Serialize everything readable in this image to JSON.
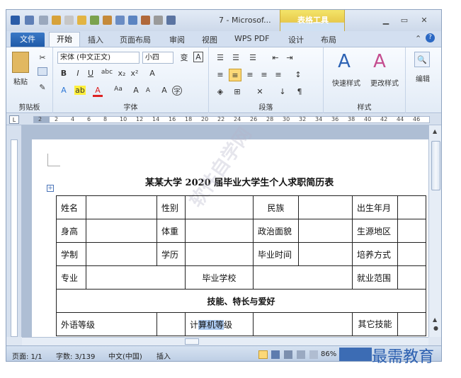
{
  "title_bar": {
    "doc_title": "7 - Microsof...",
    "context_tab": "表格工具"
  },
  "tabs": [
    "文件",
    "开始",
    "插入",
    "页面布局",
    "审阅",
    "视图",
    "WPS PDF",
    "设计",
    "布局"
  ],
  "ribbon": {
    "clipboard": {
      "paste": "粘贴",
      "label": "剪贴板"
    },
    "font": {
      "font_name": "宋体 (中文正文)",
      "font_size": "小四",
      "label": "字体"
    },
    "paragraph": {
      "label": "段落"
    },
    "styles": {
      "quick": "快速样式",
      "change": "更改样式",
      "label": "样式"
    },
    "edit": {
      "label": "编辑"
    }
  },
  "ruler": {
    "numbers": [
      "2",
      "2",
      "4",
      "6",
      "8",
      "10",
      "12",
      "14",
      "16",
      "18",
      "20",
      "22",
      "24",
      "26",
      "28",
      "30",
      "32",
      "34",
      "36",
      "38",
      "40",
      "42",
      "44",
      "46"
    ]
  },
  "document": {
    "title": "某某大学 2020 届毕业大学生个人求职简历表",
    "watermark": "软件自学网",
    "rows": [
      [
        "姓名",
        "",
        "性别",
        "",
        "民族",
        "",
        "出生年月",
        ""
      ],
      [
        "身高",
        "",
        "体重",
        "",
        "政治面貌",
        "",
        "生源地区",
        ""
      ],
      [
        "学制",
        "",
        "学历",
        "",
        "毕业时间",
        "",
        "培养方式",
        ""
      ],
      [
        "专业",
        "",
        "毕业学校",
        "",
        "就业范围",
        ""
      ],
      [
        "技能、特长与爱好"
      ],
      [
        "外语等级",
        "",
        "计算机等级",
        "",
        "其它技能",
        ""
      ]
    ],
    "highlight": "算机等"
  },
  "status": {
    "page": "页面: 1/1",
    "words": "字数: 3/139",
    "lang": "中文(中国)",
    "mode": "插入",
    "zoom": "86%"
  },
  "brand": "最需教育",
  "colors": {
    "file_tab": "#2a67b6",
    "context": "#e9cc4e"
  }
}
